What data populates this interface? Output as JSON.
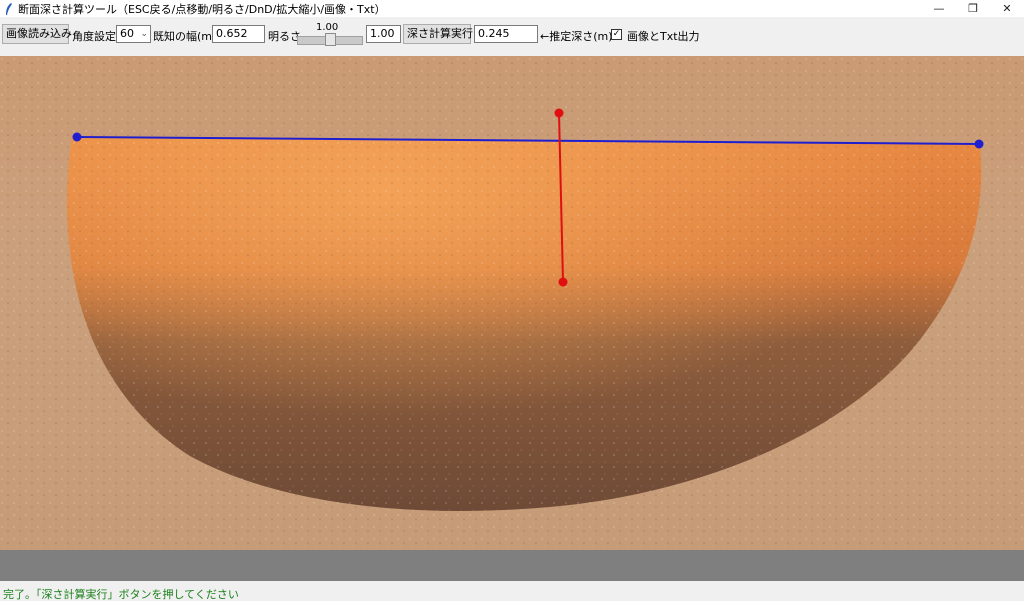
{
  "window": {
    "title": "断面深さ計算ツール（ESC戻る/点移動/明るさ/DnD/拡大縮小/画像・Txt）",
    "minimize_glyph": "—",
    "restore_glyph": "❐",
    "close_glyph": "✕"
  },
  "toolbar": {
    "load_image_label": "画像読み込み",
    "angle_label": "角度設定",
    "angle_value": "60",
    "known_width_label": "既知の幅(m):",
    "known_width_value": "0.652",
    "brightness_label": "明るさ",
    "brightness_scale_value": "1.00",
    "brightness_entry_value": "1.00",
    "brightness_fraction": 0.5,
    "calculate_label": "深さ計算実行",
    "depth_value": "0.245",
    "depth_label": "←推定深さ(m)",
    "output_checked": true,
    "output_label": "画像とTxt出力",
    "checkbox_mark": "✓"
  },
  "status": {
    "text": "完了。「深さ計算実行」ボタンを押してください"
  },
  "colors": {
    "width_line": "#1f1fd0",
    "depth_line": "#e01010",
    "status_text": "#1a7f1a"
  }
}
